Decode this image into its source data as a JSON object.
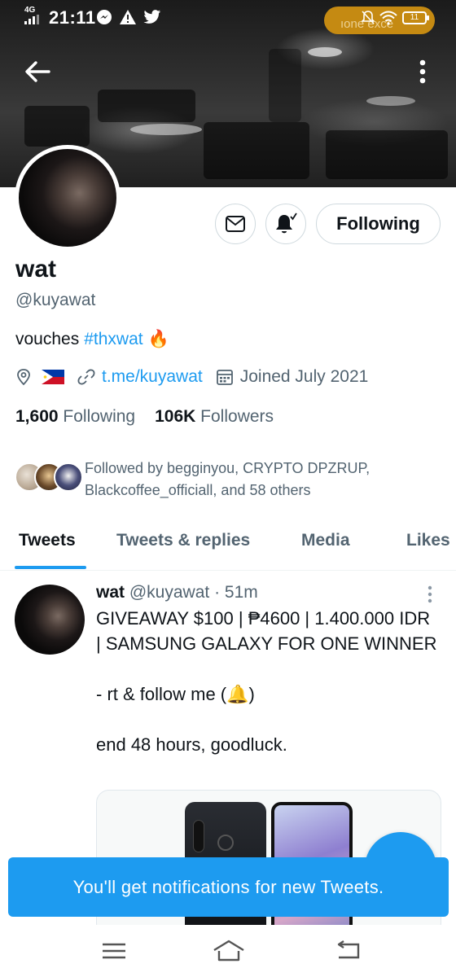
{
  "status_bar": {
    "network": "4G",
    "time": "21:11",
    "left_icons": [
      "messenger-icon",
      "alert-icon",
      "twitter-icon"
    ],
    "pill_text": "ıone exce",
    "battery": "11"
  },
  "profile": {
    "name": "wat",
    "handle": "@kuyawat",
    "bio_text": "vouches",
    "bio_hashtag": "#thxwat",
    "bio_emoji": "🔥",
    "location_flag": "philippines-flag",
    "link": "t.me/kuyawat",
    "joined": "Joined July 2021",
    "following_count": "1,600",
    "following_label": "Following",
    "followers_count": "106K",
    "followers_label": "Followers",
    "followed_by": "Followed by begginyou, CRYPTO DPZRUP, Blackcoffee_officiall, and 58 others",
    "follow_button": "Following"
  },
  "tabs": [
    {
      "label": "Tweets",
      "active": true
    },
    {
      "label": "Tweets & replies",
      "active": false
    },
    {
      "label": "Media",
      "active": false
    },
    {
      "label": "Likes",
      "active": false
    }
  ],
  "tweet": {
    "name": "wat",
    "handle": "@kuyawat",
    "time": "· 51m",
    "line1": "GIVEAWAY $100 | ₱4600 | 1.400.000 IDR | SAMSUNG GALAXY FOR ONE WINNER",
    "line2": "- rt & follow me (🔔)",
    "line3": "end 48 hours, goodluck."
  },
  "toast": "You'll get notifications for new Tweets.",
  "colors": {
    "accent": "#1d9bf0",
    "secondary_text": "#536471",
    "primary_text": "#0f1419",
    "status_pill": "#c58a12"
  }
}
